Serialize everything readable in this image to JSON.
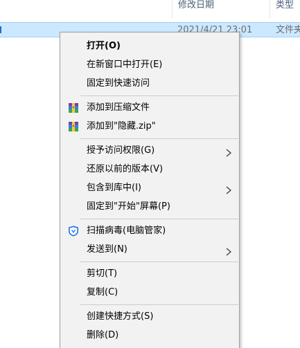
{
  "columns": {
    "modified": "修改日期",
    "type": "类型"
  },
  "file_row": {
    "modified": "2021/4/21 23:01",
    "type": "文件夹"
  },
  "menu": {
    "open": "打开(O)",
    "open_new_window": "在新窗口中打开(E)",
    "pin_quick_access": "固定到快速访问",
    "add_to_archive": "添加到压缩文件",
    "add_to_zip": "添加到\"隐藏.zip\"",
    "grant_access": "授予访问权限(G)",
    "restore_previous": "还原以前的版本(V)",
    "include_in_library": "包含到库中(I)",
    "pin_to_start": "固定到\"开始\"屏幕(P)",
    "scan_virus": "扫描病毒(电脑管家)",
    "send_to": "发送到(N)",
    "cut": "剪切(T)",
    "copy": "复制(C)",
    "create_shortcut": "创建快捷方式(S)",
    "delete": "删除(D)"
  },
  "colors": {
    "selection": "#cce8ff",
    "menu_bg": "#f2f2f2",
    "shield_blue": "#1a73e8"
  },
  "icons": {
    "archive": "winrar-archive-icon",
    "shield": "tencent-pc-manager-shield-icon",
    "submenu": "chevron-right-icon"
  }
}
